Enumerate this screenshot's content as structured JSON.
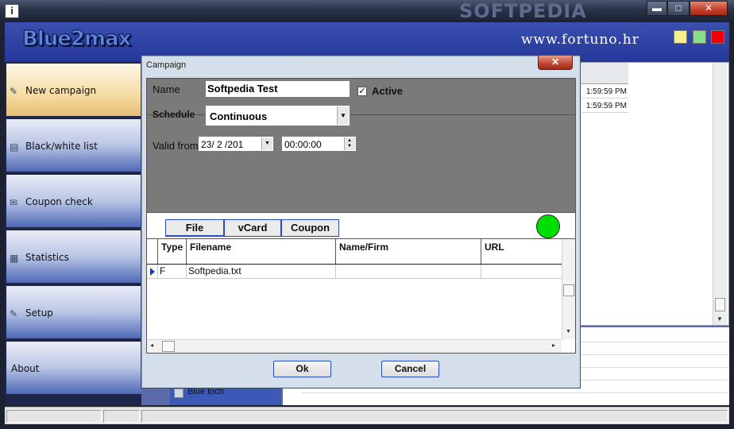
{
  "window": {
    "title_watermark": "SOFTPEDIA",
    "min_glyph": "▬",
    "max_glyph": "□",
    "close_glyph": "✕",
    "app_icon_glyph": "i"
  },
  "header": {
    "logo": "Blue2max",
    "url": "www.fortuno.hr",
    "swatches": [
      "#f6f08a",
      "#86e08a",
      "#f00000"
    ]
  },
  "sidebar": {
    "items": [
      {
        "label": "New campaign",
        "icon": "new-campaign-icon",
        "glyph": "✎",
        "active": true
      },
      {
        "label": "Black/white list",
        "icon": "phone-list-icon",
        "glyph": "▤",
        "active": false
      },
      {
        "label": "Coupon check",
        "icon": "coupon-icon",
        "glyph": "✉",
        "active": false
      },
      {
        "label": "Statistics",
        "icon": "statistics-icon",
        "glyph": "▦",
        "active": false
      },
      {
        "label": "Setup",
        "icon": "setup-icon",
        "glyph": "✎",
        "active": false
      },
      {
        "label": "About",
        "icon": "",
        "glyph": "",
        "active": false
      }
    ]
  },
  "background": {
    "times": [
      "1:59:59 PM",
      "1:59:59 PM"
    ],
    "blue_touch_label": "Blue toch"
  },
  "dialog": {
    "title": "Campaign",
    "close_glyph": "✕",
    "name_label": "Name",
    "name_value": "Softpedia Test",
    "active_label": "Active",
    "active_checked": true,
    "check_glyph": "✓",
    "schedule_label": "Schedule",
    "schedule_value": "Continuous",
    "valid_from_label": "Valid from",
    "date_value": "23/ 2 /201",
    "time_value": "00:00:00",
    "tabs": [
      "File",
      "vCard",
      "Coupon"
    ],
    "active_tab": "File",
    "status_color": "#00dd00",
    "grid": {
      "columns": [
        "Type",
        "Filename",
        "Name/Firm",
        "URL"
      ],
      "rows": [
        {
          "type": "F",
          "filename": "Softpedia.txt",
          "name_firm": "",
          "url": ""
        }
      ]
    },
    "ok_label": "Ok",
    "cancel_label": "Cancel"
  }
}
